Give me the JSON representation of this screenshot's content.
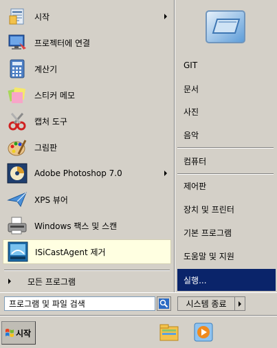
{
  "programs": [
    {
      "label": "시작",
      "icon": "startup-folder-icon",
      "has_submenu": true
    },
    {
      "label": "프로젝터에 연결",
      "icon": "projector-icon",
      "has_submenu": false
    },
    {
      "label": "계산기",
      "icon": "calculator-icon",
      "has_submenu": false
    },
    {
      "label": "스티커 메모",
      "icon": "sticky-notes-icon",
      "has_submenu": false
    },
    {
      "label": "캡처 도구",
      "icon": "snipping-tool-icon",
      "has_submenu": false
    },
    {
      "label": "그림판",
      "icon": "paint-icon",
      "has_submenu": false
    },
    {
      "label": "Adobe Photoshop 7.0",
      "icon": "photoshop-icon",
      "has_submenu": true
    },
    {
      "label": "XPS 뷰어",
      "icon": "xps-viewer-icon",
      "has_submenu": false
    },
    {
      "label": "Windows 팩스 및 스캔",
      "icon": "fax-scan-icon",
      "has_submenu": false
    },
    {
      "label": "ISiCastAgent 제거",
      "icon": "uninstall-icon",
      "has_submenu": false
    }
  ],
  "all_programs_label": "모든 프로그램",
  "search_placeholder": "프로그램 및 파일 검색",
  "right_items": [
    {
      "label": "GIT"
    },
    {
      "label": "문서"
    },
    {
      "label": "사진"
    },
    {
      "label": "음악"
    },
    {
      "label": "컴퓨터"
    },
    {
      "label": "제어판"
    },
    {
      "label": "장치 및 프린터"
    },
    {
      "label": "기본 프로그램"
    },
    {
      "label": "도움말 및 지원"
    },
    {
      "label": "실행..."
    }
  ],
  "shutdown_label": "시스템 종료",
  "taskbar": {
    "start_label": "시작"
  },
  "colors": {
    "selected": "#0a246a",
    "highlight": "#ffffe1",
    "menu_bg": "#d4d0c8"
  }
}
